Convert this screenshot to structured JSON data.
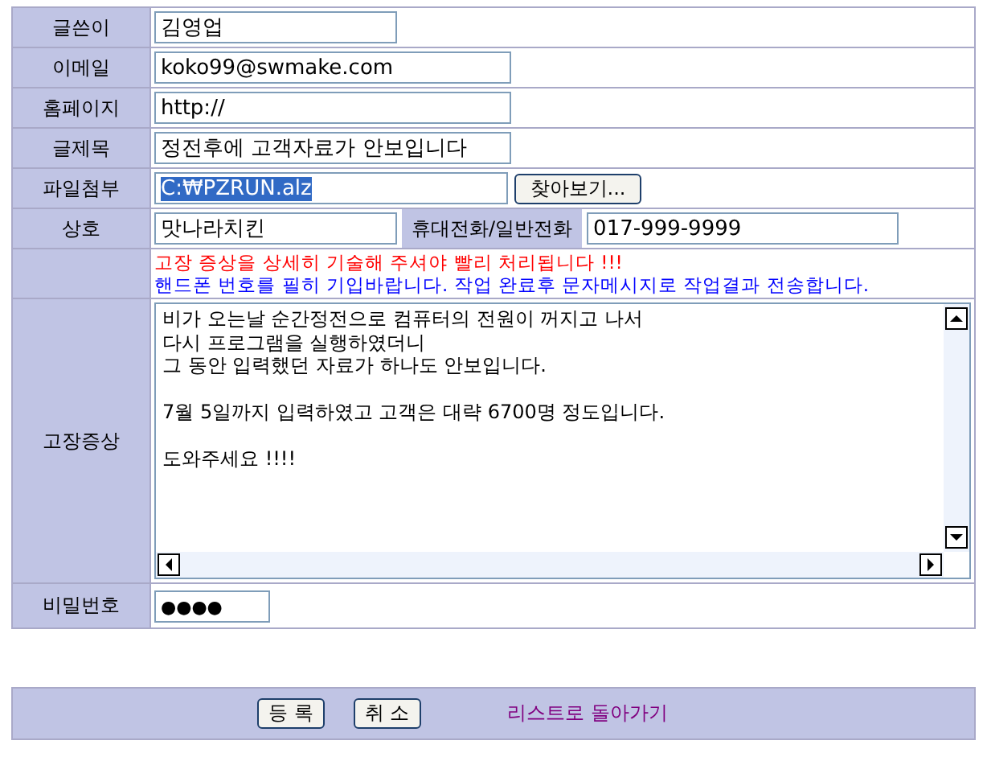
{
  "form": {
    "rows": [
      {
        "kind": "short_text",
        "label": "글쓴이",
        "value": "김영업"
      },
      {
        "kind": "text",
        "label": "이메일",
        "value": "koko99@swmake.com"
      },
      {
        "kind": "text",
        "label": "홈페이지",
        "value": "http://"
      },
      {
        "kind": "text",
        "label": "글제목",
        "value": "정전후에 고객자료가 안보입니다"
      },
      {
        "kind": "file",
        "label": "파일첨부",
        "value": "C:₩PZRUN.alz",
        "selected": true,
        "button": "찾아보기..."
      },
      {
        "kind": "company",
        "label": "상호",
        "value": "맛나라치킨",
        "phone_label": "휴대전화/일반전화",
        "phone": "017-999-9999"
      },
      {
        "kind": "notice",
        "lines": [
          {
            "text": "고장 증상을 상세히 기술해 주셔야 빨리 처리됩니다 !!!",
            "color": "#ff0000"
          },
          {
            "text": "핸드폰 번호를 필히 기입바랍니다. 작업 완료후  문자메시지로 작업결과 전송합니다.",
            "color": "#0000ff"
          }
        ]
      },
      {
        "kind": "textarea",
        "label": "고장증상",
        "paragraphs": [
          [
            "비가 오는날 순간정전으로 컴퓨터의 전원이 꺼지고 나서",
            "다시 프로그램을 실행하였더니",
            "그 동안 입력했던 자료가 하나도 안보입니다."
          ],
          [
            "7월 5일까지 입력하였고 고객은 대략 6700명 정도입니다."
          ],
          [
            "도와주세요 !!!!"
          ]
        ]
      },
      {
        "kind": "password",
        "label": "비밀번호",
        "value": "●●●●"
      }
    ]
  },
  "footer": {
    "buttons": [
      "등 록",
      "취 소"
    ],
    "link": "리스트로 돌아가기"
  }
}
